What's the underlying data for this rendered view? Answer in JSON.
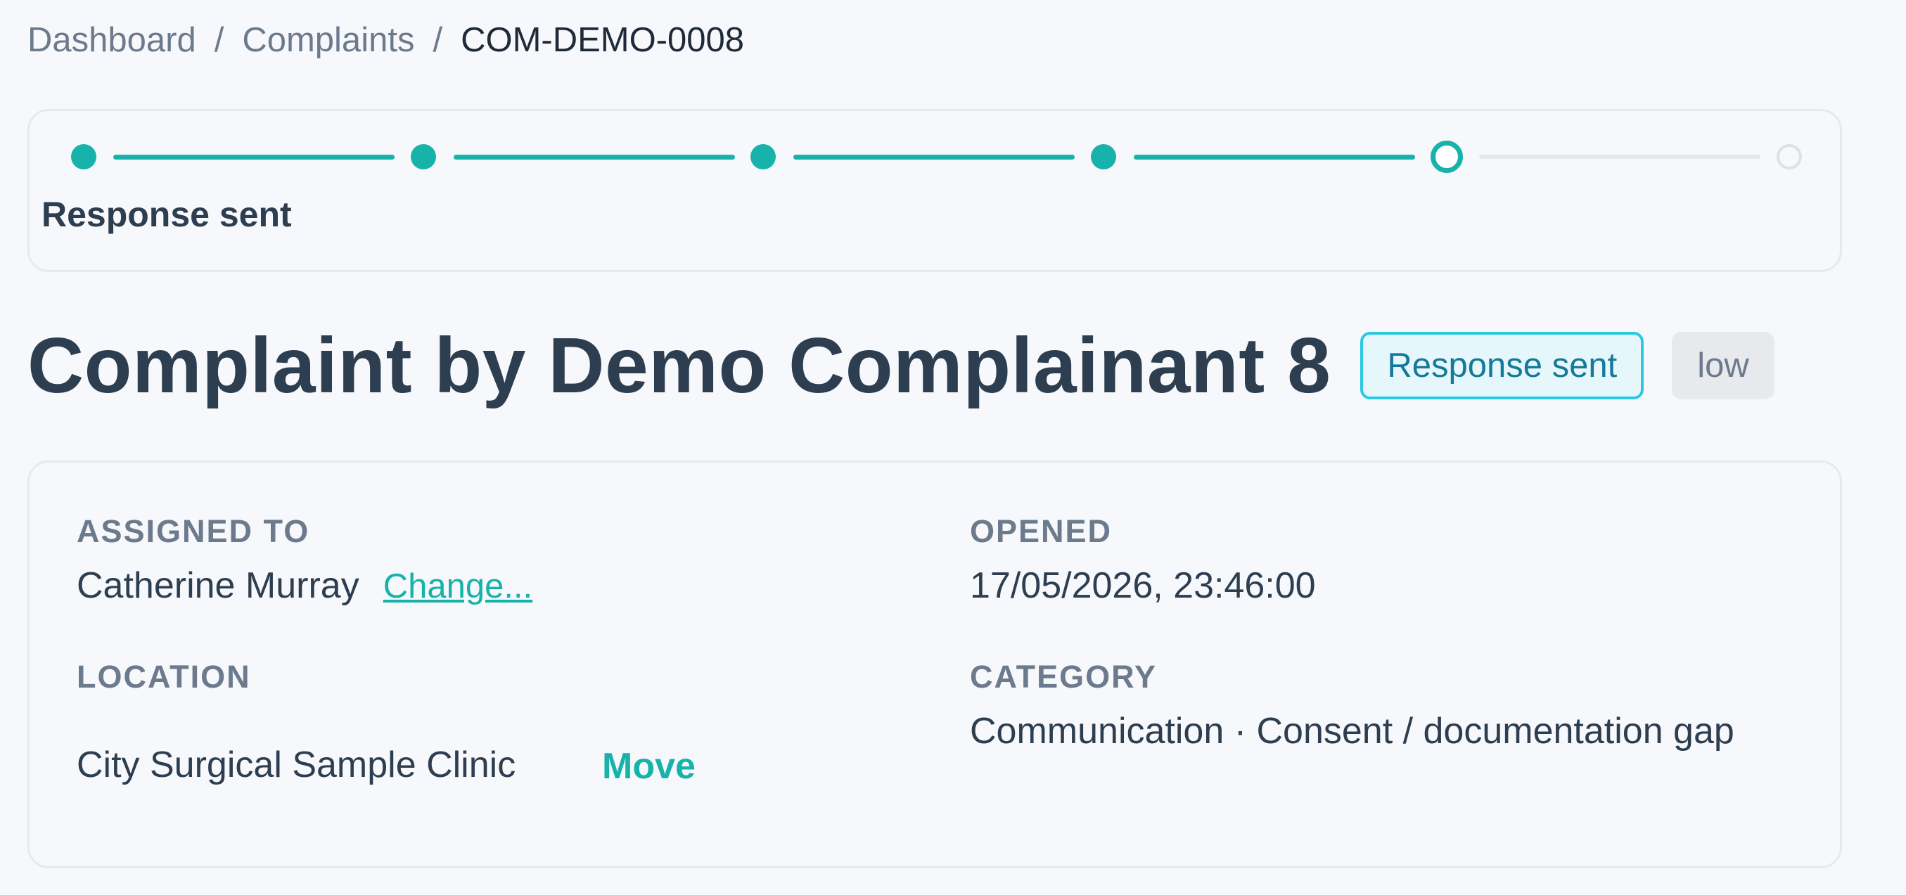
{
  "breadcrumb": {
    "items": [
      "Dashboard",
      "Complaints"
    ],
    "current": "COM-DEMO-0008",
    "separator": "/"
  },
  "stepper": {
    "current_step_label": "Response sent",
    "steps_total": 6,
    "steps_completed": 4,
    "current_index": 4
  },
  "complaint": {
    "title": "Complaint by Demo Complainant 8",
    "status": "Response sent",
    "priority": "low"
  },
  "details": {
    "assigned_to_label": "ASSIGNED TO",
    "assigned_to_value": "Catherine Murray",
    "change_label": "Change...",
    "opened_label": "OPENED",
    "opened_value": "17/05/2026, 23:46:00",
    "location_label": "LOCATION",
    "location_value": "City Surgical Sample Clinic",
    "move_label": "Move",
    "category_label": "CATEGORY",
    "category_value": "Communication · Consent / documentation gap"
  },
  "colors": {
    "accent": "#17b3aa",
    "status_border": "#2cc8e3",
    "status_text": "#14799a",
    "text_primary": "#2d3e50",
    "text_muted": "#6b7a8c"
  }
}
